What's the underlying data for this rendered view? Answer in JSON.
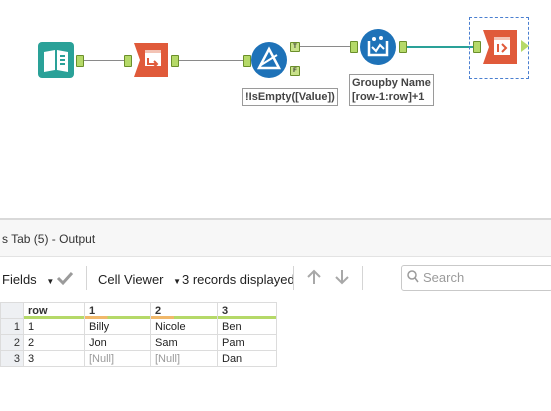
{
  "workflow": {
    "filter_annotation": "!IsEmpty([Value])",
    "filter_true_badge": "T",
    "filter_false_badge": "F",
    "summarize_annotation_line1": "Groupby Name",
    "summarize_annotation_line2": "[row-1:row]+1"
  },
  "output": {
    "title": "s Tab (5) - Output",
    "fields_label": "Fields",
    "cell_viewer_label": "Cell Viewer",
    "records_label": "3 records displayed",
    "search_placeholder": "Search"
  },
  "grid": {
    "columns": [
      "row",
      "1",
      "2",
      "3"
    ],
    "rows": [
      {
        "num": "1",
        "cells": [
          "1",
          "Billy",
          "Nicole",
          "Ben"
        ]
      },
      {
        "num": "2",
        "cells": [
          "2",
          "Jon",
          "Sam",
          "Pam"
        ]
      },
      {
        "num": "3",
        "cells": [
          "3",
          "[Null]",
          "[Null]",
          "Dan"
        ]
      }
    ]
  },
  "colors": {
    "connector": "#8a8a8a",
    "anchor_green": "#b5d968",
    "tool_red": "#e05a3a",
    "tool_blue": "#1e72b8",
    "tool_teal": "#2aa198",
    "selection": "#4a7fd0"
  }
}
